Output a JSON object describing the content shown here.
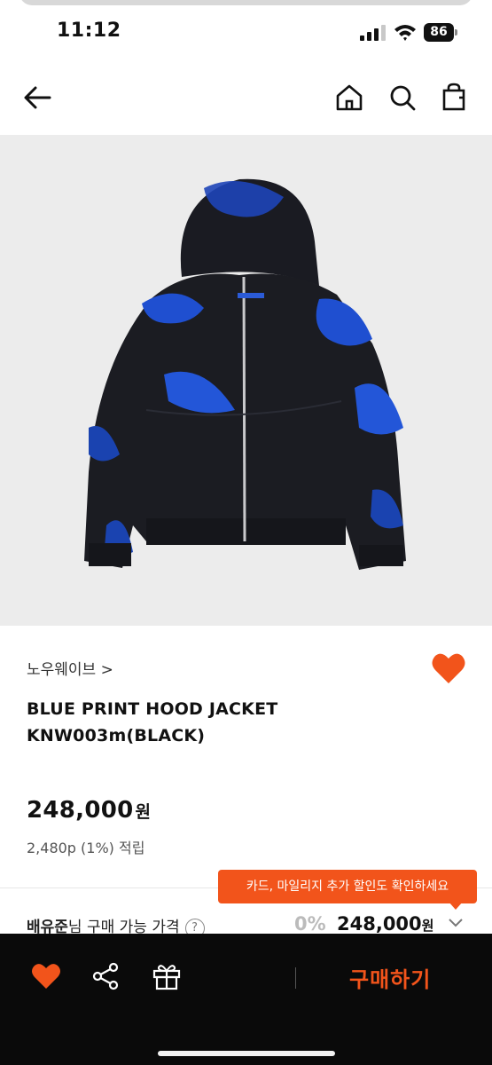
{
  "status": {
    "time": "11:12",
    "battery": "86"
  },
  "header": {
    "back_icon": "back-arrow-icon",
    "home_icon": "home-icon",
    "search_icon": "search-icon",
    "bag_icon": "shopping-bag-icon"
  },
  "product": {
    "brand": "노우웨이브 >",
    "name_line1": "BLUE PRINT HOOD JACKET",
    "name_line2": "KNW003m(BLACK)",
    "price": "248,000",
    "price_unit": "원",
    "points": "2,480p (1%) 적립",
    "liked": true
  },
  "tooltip": {
    "text": "카드, 마일리지 추가 할인도 확인하세요"
  },
  "member_price": {
    "user": "배유준",
    "label": "님 구매 가능 가격",
    "help": "?",
    "percent": "0%",
    "price": "248,000",
    "unit": "원"
  },
  "bottom_bar": {
    "buy_label": "구매하기"
  },
  "colors": {
    "accent": "#f2541b",
    "bar": "#0a0a0a"
  }
}
